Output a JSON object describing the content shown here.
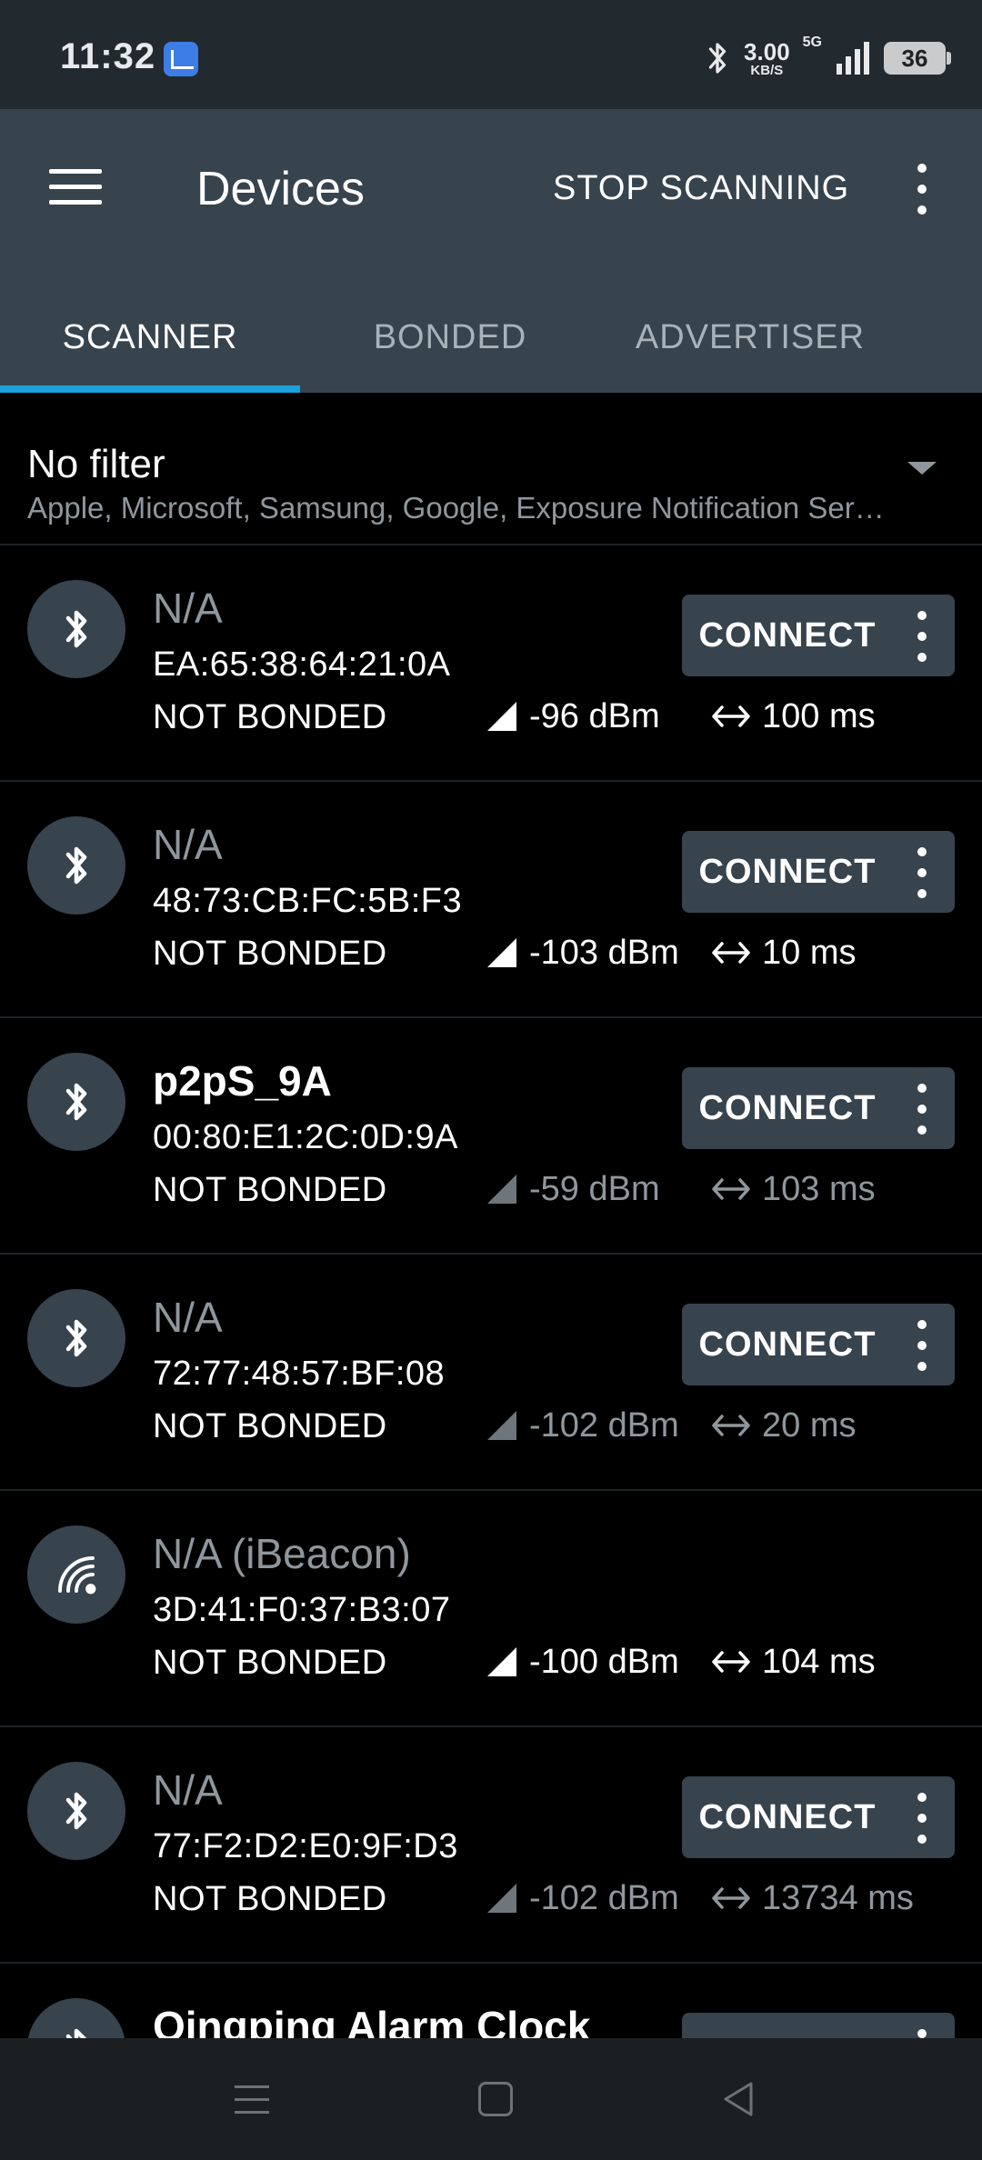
{
  "status_bar": {
    "time": "11:32",
    "net_speed_value": "3.00",
    "net_speed_unit": "KB/S",
    "network": "5G",
    "battery": "36",
    "icons": [
      "app-notification-icon",
      "bluetooth-icon",
      "signal-icon",
      "battery-icon"
    ]
  },
  "app_bar": {
    "title": "Devices",
    "action": "STOP SCANNING"
  },
  "tabs": [
    {
      "label": "SCANNER",
      "active": true
    },
    {
      "label": "BONDED",
      "active": false
    },
    {
      "label": "ADVERTISER",
      "active": false
    }
  ],
  "filter": {
    "title": "No filter",
    "subtitle": "Apple, Microsoft, Samsung, Google, Exposure Notification Ser…"
  },
  "devices": [
    {
      "name": "N/A",
      "address": "EA:65:38:64:21:0A",
      "bond": "NOT BONDED",
      "rssi": "-96 dBm",
      "interval": "100 ms",
      "icon": "bluetooth-icon",
      "connect": "CONNECT",
      "named": false,
      "active": true
    },
    {
      "name": "N/A",
      "address": "48:73:CB:FC:5B:F3",
      "bond": "NOT BONDED",
      "rssi": "-103 dBm",
      "interval": "10 ms",
      "icon": "bluetooth-icon",
      "connect": "CONNECT",
      "named": false,
      "active": true
    },
    {
      "name": "p2pS_9A",
      "address": "00:80:E1:2C:0D:9A",
      "bond": "NOT BONDED",
      "rssi": "-59 dBm",
      "interval": "103 ms",
      "icon": "bluetooth-icon",
      "connect": "CONNECT",
      "named": true,
      "active": false
    },
    {
      "name": "N/A",
      "address": "72:77:48:57:BF:08",
      "bond": "NOT BONDED",
      "rssi": "-102 dBm",
      "interval": "20 ms",
      "icon": "bluetooth-icon",
      "connect": "CONNECT",
      "named": false,
      "active": false
    },
    {
      "name": "N/A  (iBeacon)",
      "address": "3D:41:F0:37:B3:07",
      "bond": "NOT BONDED",
      "rssi": "-100 dBm",
      "interval": "104 ms",
      "icon": "beacon-icon",
      "connect": "",
      "named": false,
      "active": true
    },
    {
      "name": "N/A",
      "address": "77:F2:D2:E0:9F:D3",
      "bond": "NOT BONDED",
      "rssi": "-102 dBm",
      "interval": "13734 ms",
      "icon": "bluetooth-icon",
      "connect": "CONNECT",
      "named": false,
      "active": false
    },
    {
      "name": "Qingping Alarm Clock",
      "address": "",
      "bond": "",
      "rssi": "",
      "interval": "",
      "icon": "bluetooth-icon",
      "connect": "CONNECT",
      "named": true,
      "active": false
    }
  ],
  "colors": {
    "app_bar": "#37434d",
    "tab_indicator": "#1ba2dc",
    "background": "#000000",
    "dim_text": "#8f979c"
  }
}
